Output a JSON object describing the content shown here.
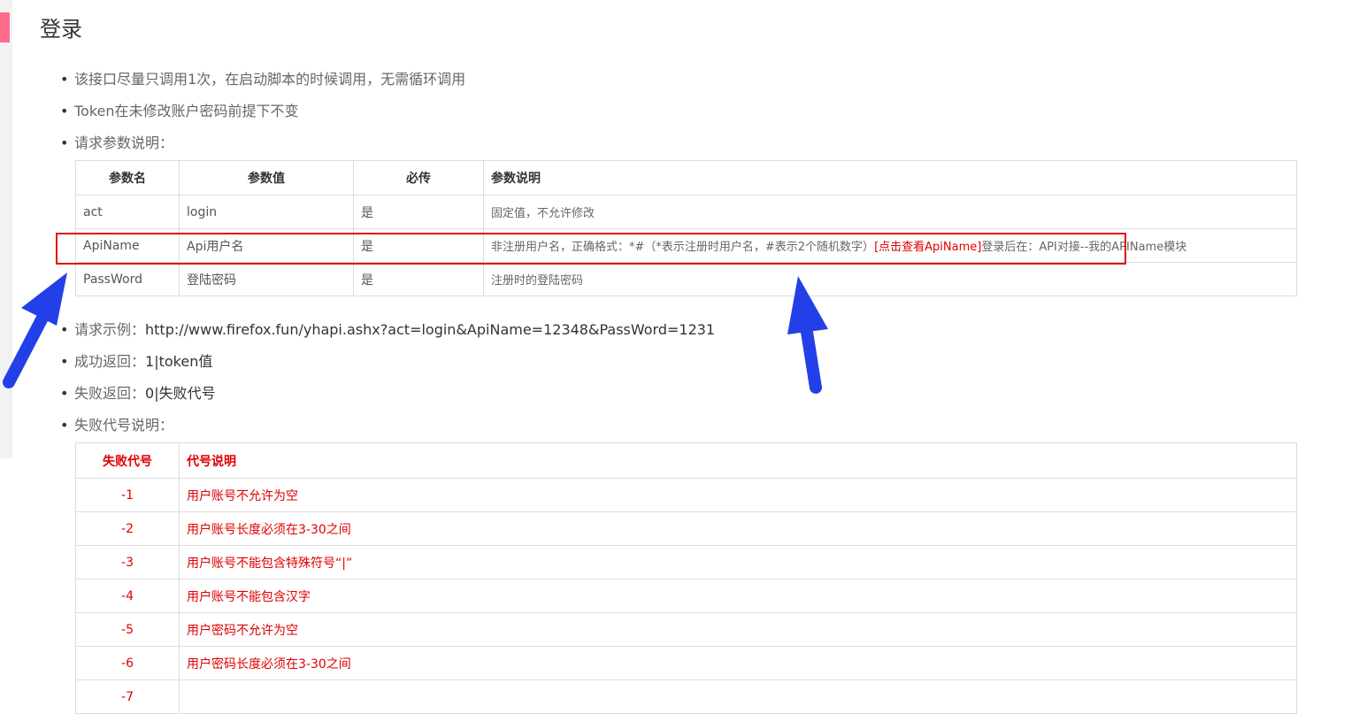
{
  "page": {
    "title": "登录"
  },
  "bullets_top": [
    {
      "prefix": "该接口尽量只调用1次，在启动脚本的时候调用，无需循环调用",
      "value": ""
    },
    {
      "prefix": "Token在未修改账户密码前提下不变",
      "value": ""
    },
    {
      "prefix": "请求参数说明：",
      "value": ""
    }
  ],
  "param_table": {
    "headers": [
      "参数名",
      "参数值",
      "必传",
      "参数说明"
    ],
    "rows": [
      {
        "name": "act",
        "value": "login",
        "required": "是",
        "desc": "固定值，不允许修改",
        "link": "",
        "desc_tail": ""
      },
      {
        "name": "ApiName",
        "value": "Api用户名",
        "required": "是",
        "desc": "非注册用户名，正确格式：*#（*表示注册时用户名，#表示2个随机数字）",
        "link": "[点击查看ApiName]",
        "desc_tail": "登录后在：API对接--我的APIName模块"
      },
      {
        "name": "PassWord",
        "value": "登陆密码",
        "required": "是",
        "desc": "注册时的登陆密码",
        "link": "",
        "desc_tail": ""
      }
    ]
  },
  "bullets_bottom": [
    {
      "prefix": "请求示例：",
      "value": "http://www.firefox.fun/yhapi.ashx?act=login&ApiName=12348&PassWord=1231"
    },
    {
      "prefix": "成功返回：",
      "value": "1|token值"
    },
    {
      "prefix": "失败返回：",
      "value": "0|失败代号"
    },
    {
      "prefix": "失败代号说明：",
      "value": ""
    }
  ],
  "error_table": {
    "headers": [
      "失败代号",
      "代号说明"
    ],
    "rows": [
      {
        "code": "-1",
        "msg": "用户账号不允许为空"
      },
      {
        "code": "-2",
        "msg": "用户账号长度必须在3-30之间"
      },
      {
        "code": "-3",
        "msg": "用户账号不能包含特殊符号“|”"
      },
      {
        "code": "-4",
        "msg": "用户账号不能包含汉字"
      },
      {
        "code": "-5",
        "msg": "用户密码不允许为空"
      },
      {
        "code": "-6",
        "msg": "用户密码长度必须在3-30之间"
      },
      {
        "code": "-7",
        "msg": ""
      }
    ]
  },
  "colors": {
    "accent_pink": "#ff6b8b",
    "error_red": "#e00000",
    "highlight_red": "#e01010",
    "arrow_blue": "#2340e8"
  }
}
